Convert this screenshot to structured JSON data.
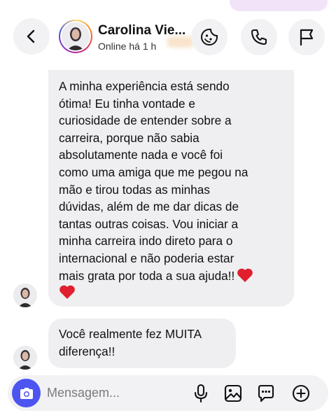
{
  "header": {
    "contact_name": "Carolina Vie...",
    "status": "Online há 1 h"
  },
  "messages": [
    {
      "lines": [
        "A minha experiência está sendo",
        "ótima! Eu tinha vontade e",
        "curiosidade de entender sobre a",
        "carreira, porque não sabia",
        "absolutamente nada e você foi",
        "como uma amiga que me pegou na",
        "mão e tirou todas as minhas",
        "dúvidas, além de me dar dicas de",
        "tantas outras coisas. Vou iniciar a",
        "minha carreira indo direto para o",
        "internacional e não poderia estar",
        "mais grata por toda a sua ajuda!!"
      ],
      "emoji": [
        "red-heart",
        "red-heart"
      ]
    },
    {
      "lines": [
        "Você realmente fez MUITA",
        "diferença!!"
      ]
    }
  ],
  "composer": {
    "placeholder": "Mensagem..."
  },
  "colors": {
    "bubble": "#efeff2",
    "accent": "#4d55f0",
    "heart": "#e0202e",
    "icon_button": "#f2f2f4"
  }
}
